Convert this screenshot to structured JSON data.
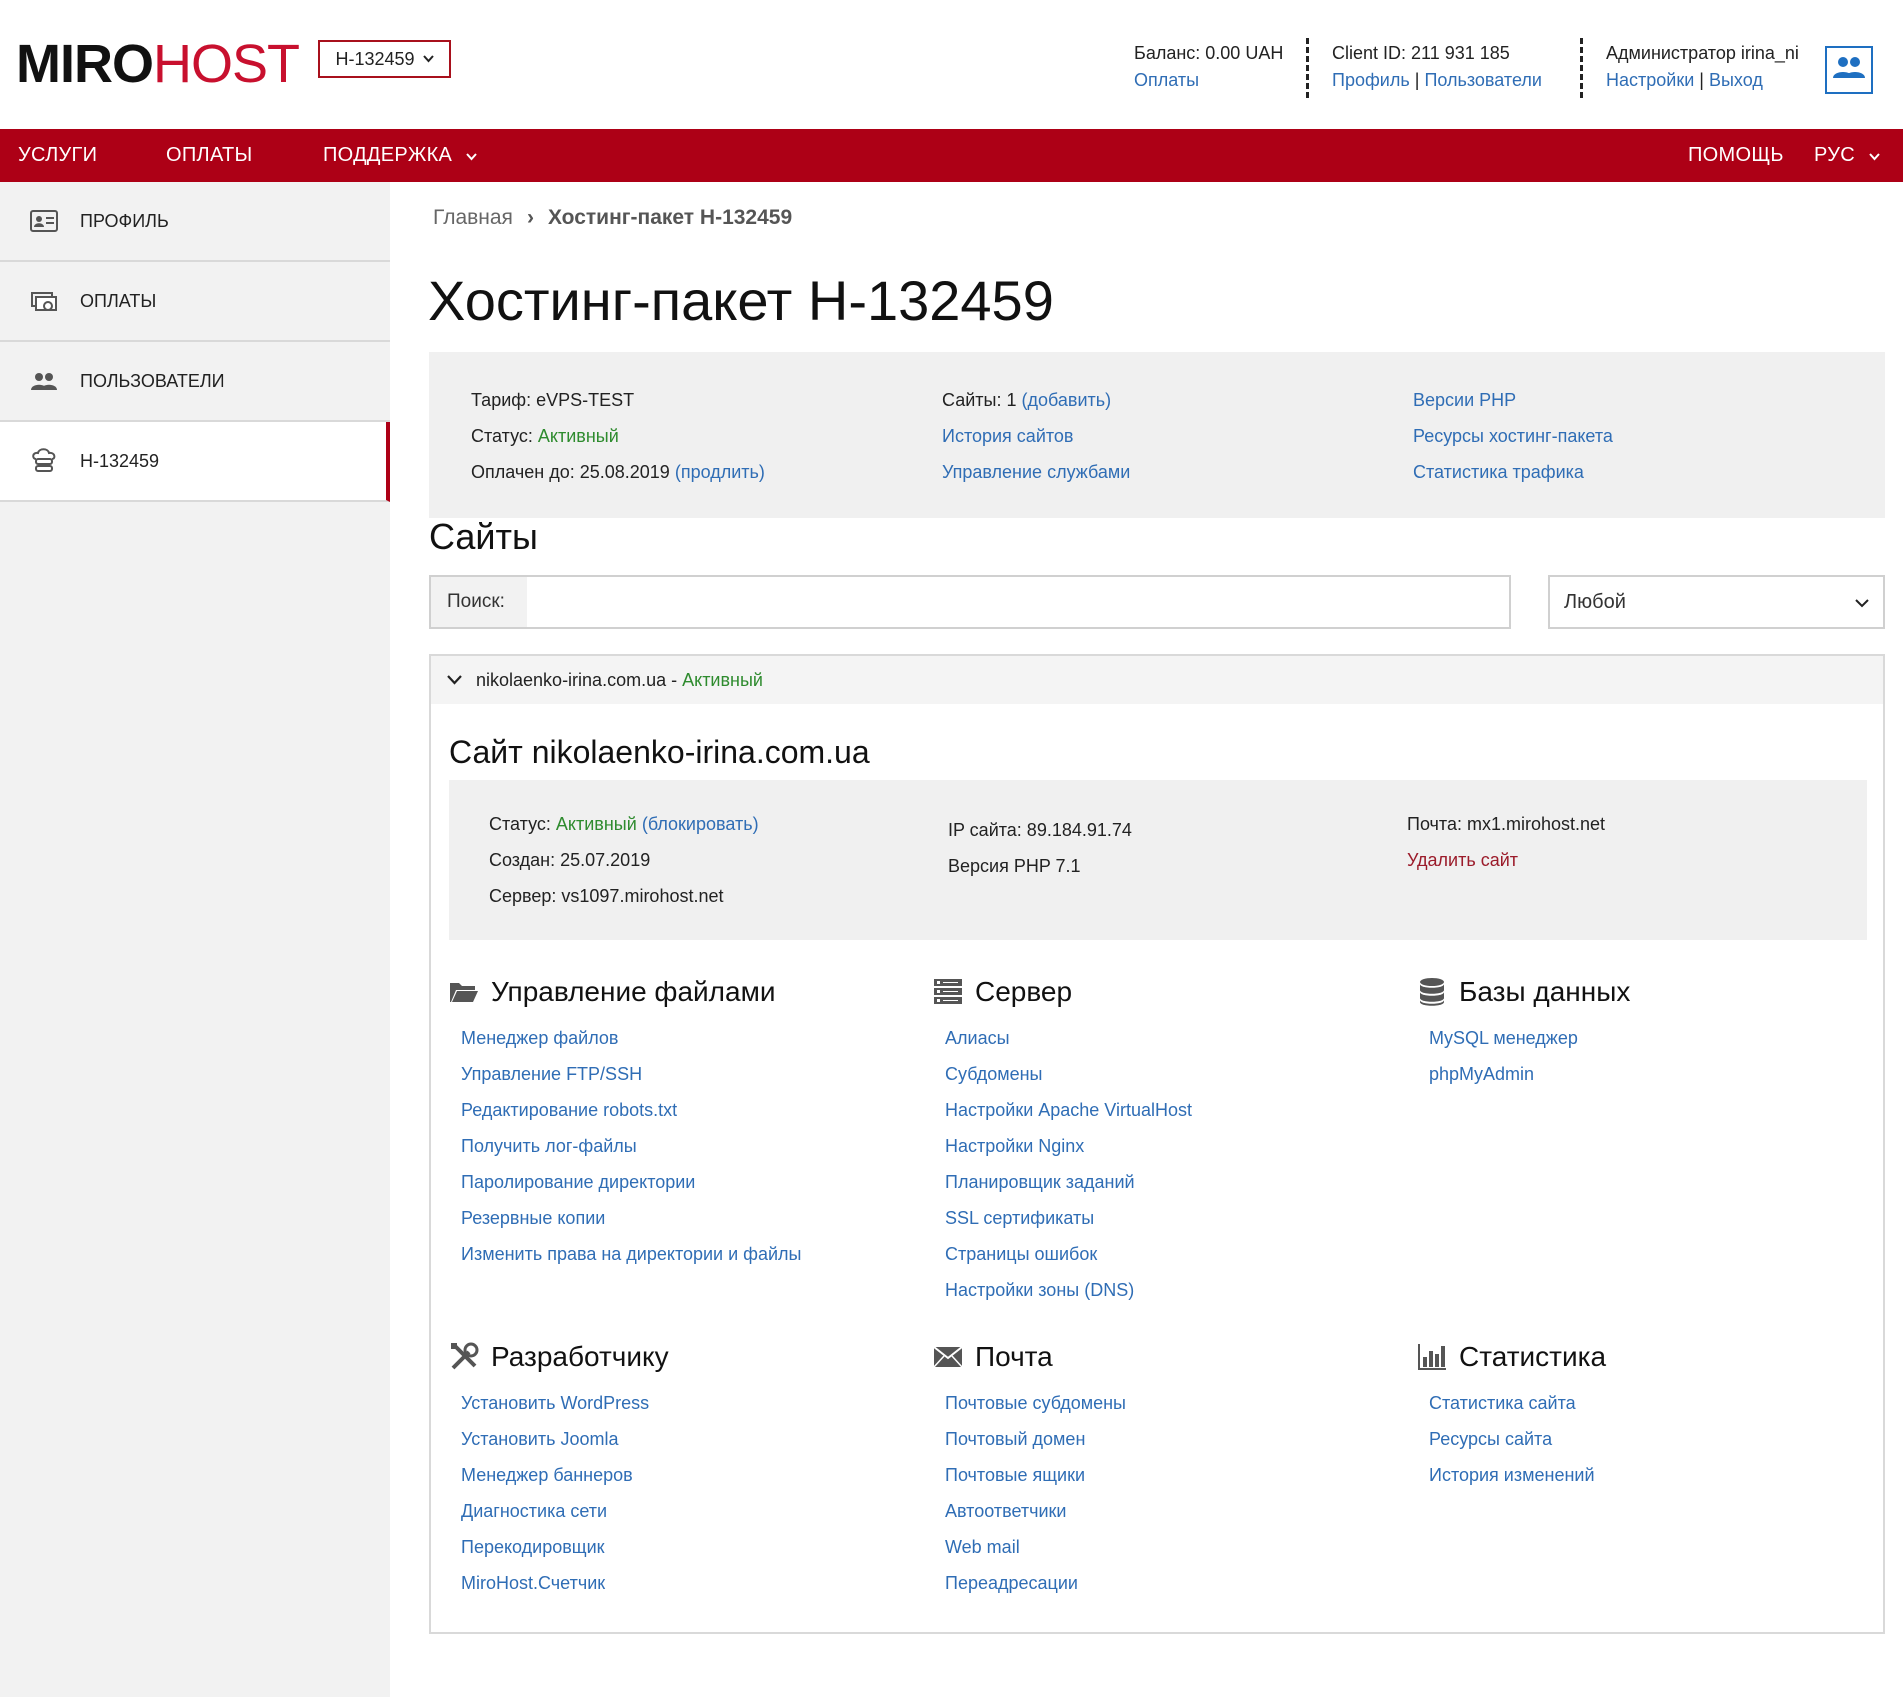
{
  "header": {
    "logo_part1": "MIRO",
    "logo_part2": "HOST",
    "package_select": "H-132459",
    "balance_label": "Баланс: 0.00 UAH",
    "payments_link": "Оплаты",
    "client_id": "Client ID: 211 931 185",
    "profile_link": "Профиль",
    "users_link": "Пользователи",
    "link_sep": "|",
    "admin_label": "Администратор irina_ni",
    "settings_link": "Настройки",
    "logout_link": "Выход",
    "user_icon": "users-icon"
  },
  "nav": {
    "services": "УСЛУГИ",
    "payments": "ОПЛАТЫ",
    "support": "ПОДДЕРЖКА",
    "help": "ПОМОЩЬ",
    "language": "РУС"
  },
  "sidebar": {
    "items": [
      {
        "label": "ПРОФИЛЬ",
        "icon": "profile-card-icon"
      },
      {
        "label": "ОПЛАТЫ",
        "icon": "payments-icon"
      },
      {
        "label": "ПОЛЬЗОВАТЕЛИ",
        "icon": "users-icon"
      },
      {
        "label": "H-132459",
        "icon": "hosting-icon"
      }
    ]
  },
  "breadcrumb": {
    "home": "Главная",
    "separator": "›",
    "current": "Хостинг-пакет H-132459"
  },
  "page_title": "Хостинг-пакет H-132459",
  "info": {
    "tariff": "Тариф: eVPS-TEST",
    "status_label": "Статус:",
    "status_value": "Активный",
    "paid_until": "Оплачен до: 25.08.2019",
    "extend_link": "(продлить)",
    "sites_count": "Сайты: 1",
    "add_site_link": "(добавить)",
    "sites_history": "История сайтов",
    "services_management": "Управление службами",
    "php_versions": "Версии PHP",
    "package_resources": "Ресурсы хостинг-пакета",
    "traffic_stats": "Статистика трафика"
  },
  "sites": {
    "title": "Сайты",
    "search_label": "Поиск:",
    "search_value": "",
    "filter_value": "Любой"
  },
  "site": {
    "domain": "nikolaenko-irina.com.ua",
    "head_sep": " - ",
    "status_word": "Активный",
    "title": "Сайт nikolaenko-irina.com.ua",
    "status_label": "Статус:",
    "status_value": "Активный",
    "block_link": "(блокировать)",
    "created": "Создан: 25.07.2019",
    "server": "Сервер: vs1097.mirohost.net",
    "ip": "IP сайта: 89.184.91.74",
    "php_version": "Версия PHP 7.1",
    "mail": "Почта: mx1.mirohost.net",
    "delete_link": "Удалить сайт"
  },
  "sections": {
    "files": {
      "title": "Управление файлами",
      "icon": "folder-icon",
      "links": [
        "Менеджер файлов",
        "Управление FTP/SSH",
        "Редактирование robots.txt",
        "Получить лог-файлы",
        "Паролирование директории",
        "Резервные копии",
        "Изменить права на директории и файлы"
      ]
    },
    "server": {
      "title": "Сервер",
      "icon": "server-icon",
      "links": [
        "Алиасы",
        "Субдомены",
        "Настройки Apache VirtualHost",
        "Настройки Nginx",
        "Планировщик заданий",
        "SSL сертификаты",
        "Страницы ошибок",
        "Настройки зоны (DNS)"
      ]
    },
    "databases": {
      "title": "Базы данных",
      "icon": "database-icon",
      "links": [
        "MySQL менеджер",
        "phpMyAdmin"
      ]
    },
    "developer": {
      "title": "Разработчику",
      "icon": "tools-icon",
      "links": [
        "Установить WordPress",
        "Установить Joomla",
        "Менеджер баннеров",
        "Диагностика сети",
        "Перекодировщик",
        "MiroHost.Счетчик"
      ]
    },
    "mail": {
      "title": "Почта",
      "icon": "envelope-icon",
      "links": [
        "Почтовые субдомены",
        "Почтовый домен",
        "Почтовые ящики",
        "Автоответчики",
        "Web mail",
        "Переадресации"
      ]
    },
    "stats": {
      "title": "Статистика",
      "icon": "bar-chart-icon",
      "links": [
        "Статистика сайта",
        "Ресурсы сайта",
        "История изменений"
      ]
    }
  },
  "colors": {
    "brand_red": "#ad0016",
    "link_blue": "#2f6db5",
    "status_green": "#2e8b2e",
    "delete_red": "#9b1b2a"
  }
}
